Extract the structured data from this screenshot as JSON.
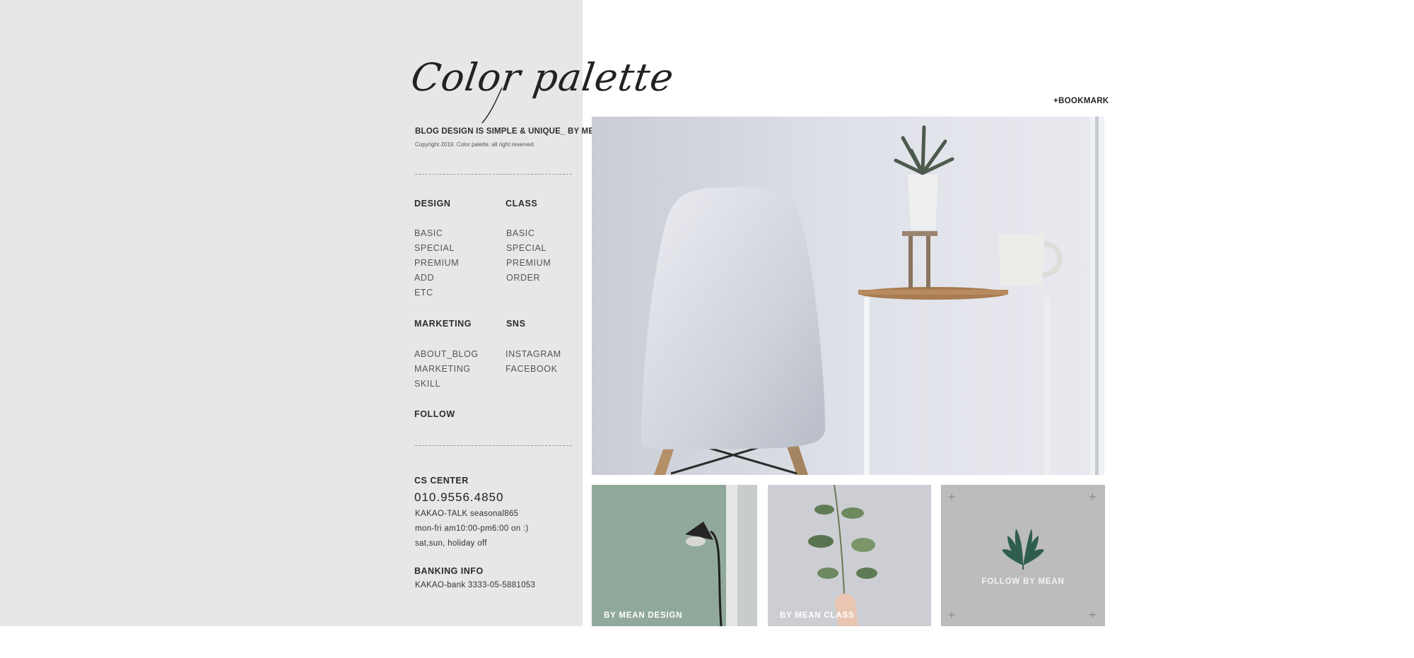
{
  "brand": {
    "logo": "Color palette",
    "tagline": "BLOG DESIGN IS SIMPLE & UNIQUE_ BY MEAN",
    "copyright": "Copyright 2019. Color palette. all right reserved."
  },
  "nav": {
    "design": {
      "heading": "DESIGN",
      "items": [
        "BASIC",
        "SPECIAL",
        "PREMIUM",
        "ADD",
        "ETC"
      ]
    },
    "class": {
      "heading": "CLASS",
      "items": [
        "BASIC",
        "SPECIAL",
        "PREMIUM",
        "ORDER"
      ]
    },
    "marketing": {
      "heading": "MARKETING",
      "items": [
        "ABOUT_BLOG",
        "MARKETING",
        "SKILL"
      ]
    },
    "sns": {
      "heading": "SNS",
      "items": [
        "INSTAGRAM",
        "FACEBOOK"
      ]
    },
    "follow": {
      "heading": "FOLLOW"
    }
  },
  "cs": {
    "heading": "CS CENTER",
    "phone": "010.9556.4850",
    "kakao": "KAKAO-TALK seasonal865",
    "hours": "mon-fri am10:00-pm6:00 on :)",
    "off": "sat,sun, holiday off"
  },
  "banking": {
    "heading": "BANKING INFO",
    "account": "KAKAO-bank 3333-05-5881053"
  },
  "main": {
    "bookmark": "+BOOKMARK",
    "tiles": [
      {
        "label": "BY MEAN DESIGN"
      },
      {
        "label": "BY MEAN CLASS"
      },
      {
        "label": "FOLLOW BY MEAN"
      }
    ]
  },
  "colors": {
    "sidebar_bg": "#e8e6e7",
    "tile_green": "#8fa898",
    "tile_gray": "#bdbcbc"
  },
  "icons": [
    "plus-icon",
    "leaf-icon"
  ]
}
